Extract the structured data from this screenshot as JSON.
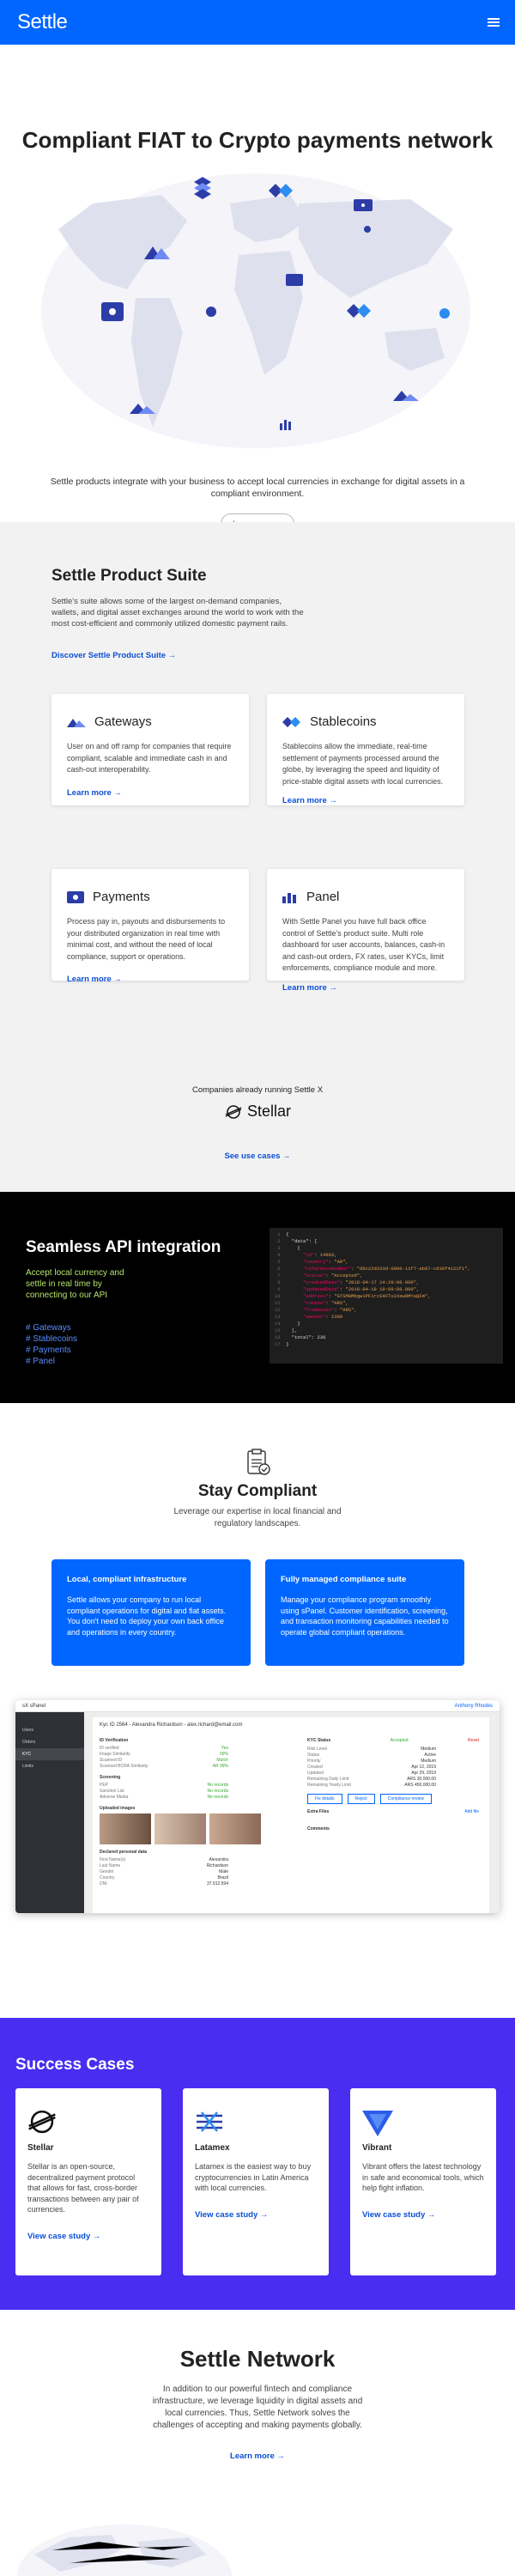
{
  "header": {
    "logo": "Settle"
  },
  "hero": {
    "title": "Compliant FIAT to Crypto payments network",
    "text": "Settle products integrate with your business to accept local currencies in exchange for digital assets in a compliant environment.",
    "cta": "Learn more →"
  },
  "suite": {
    "title": "Settle Product Suite",
    "text": "Settle's suite allows some of the largest on-demand companies, wallets, and digital asset exchanges around the world to work with the most cost-efficient and commonly utilized domestic payment rails.",
    "link": "Discover Settle Product Suite →",
    "cards": [
      {
        "title": "Gateways",
        "text": "User on and off ramp for companies that require compliant, scalable and immediate cash in and cash-out interoperability.",
        "link": "Learn more →",
        "icon": "mountain-icon"
      },
      {
        "title": "Stablecoins",
        "text": "Stablecoins allow the immediate, real-time settlement of payments processed around the globe, by leveraging the speed and liquidity of price-stable digital assets with local currencies.",
        "link": "Learn more →",
        "icon": "diamond-arrows-icon"
      },
      {
        "title": "Payments",
        "text": "Process pay in, payouts and disbursements to your distributed organization in real time with minimal cost, and without the need of local compliance, support or operations.",
        "link": "Learn more →",
        "icon": "card-icon"
      },
      {
        "title": "Panel",
        "text": "With Settle Panel you have full back office control of Settle's product suite. Multi role dashboard for user accounts, balances, cash-in and cash-out orders, FX rates, user KYCs, limit enforcements, compliance module and more.",
        "link": "Learn more →",
        "icon": "bar-chart-icon"
      }
    ],
    "companies": "Companies already running Settle X",
    "stellar": "Stellar",
    "see": "See use cases →"
  },
  "api": {
    "title": "Seamless API integration",
    "text": "Accept local currency and settle in real time by connecting to our API",
    "links": [
      "# Gateways",
      "# Stablecoins",
      "# Payments",
      "# Panel"
    ],
    "code": [
      {
        "n": "1",
        "t": "{"
      },
      {
        "n": "2",
        "t": "  \"data\": ["
      },
      {
        "n": "3",
        "t": "    {"
      },
      {
        "n": "4",
        "k": "      \"id\"",
        "v": ": 14983,"
      },
      {
        "n": "5",
        "k": "      \"country\"",
        "v": ": \"AR\","
      },
      {
        "n": "6",
        "k": "      \"referenceNumber\"",
        "v": ": \"d0c22d333d-0000-11f7-ab67-cd39f4121f1\","
      },
      {
        "n": "7",
        "k": "      \"status\"",
        "v": ": \"Accepted\","
      },
      {
        "n": "8",
        "k": "      \"createdDate\"",
        "v": ": \"2018-04-17 14:20:00.000\","
      },
      {
        "n": "9",
        "k": "      \"updatedDate\"",
        "v": ": \"2018-04-18 10:00:00.000\","
      },
      {
        "n": "10",
        "k": "      \"address\"",
        "v": ": \"GTSM8Mbgw1PF1rcS4FTu1Xew9MYaQFm\","
      },
      {
        "n": "11",
        "k": "      \"tokens\"",
        "v": ": \"ARS\","
      },
      {
        "n": "12",
        "k": "      \"fromAsset\"",
        "v": ": \"ARS\","
      },
      {
        "n": "13",
        "k": "      \"amount\"",
        "v": ": 2300"
      },
      {
        "n": "14",
        "t": "    }"
      },
      {
        "n": "15",
        "t": "  ],"
      },
      {
        "n": "16",
        "t": "  \"total\": 236"
      },
      {
        "n": "17",
        "t": "}"
      }
    ]
  },
  "compliant": {
    "title": "Stay Compliant",
    "text": "Leverage our expertise in local financial and regulatory landscapes.",
    "boxes": [
      {
        "title": "Local, compliant infrastructure",
        "text": "Settle allows your company to run local compliant operations for digital and fiat assets. You don't need to deploy your own back office and operations in every country."
      },
      {
        "title": "Fully managed compliance suite",
        "text": "Manage your compliance program smoothly using sPanel. Customer identification, screening, and transaction monitoring capabilities needed to operate global compliant operations."
      }
    ]
  },
  "panel": {
    "brand": "sX sPanel",
    "user": "Anthony Rhodes",
    "back": "Kyc ID 2564 - Alexandra Richardson - alex.richard@email.com",
    "menu": [
      "Users",
      "Orders",
      "KYC",
      "Limits"
    ],
    "status_label": "KYC Status",
    "status": "Accepted",
    "reset": "Reset",
    "kyc": [
      [
        "Risk Level",
        "Medium"
      ],
      [
        "Status",
        "Active"
      ],
      [
        "Priority",
        "Medium"
      ],
      [
        "Created",
        "Apr 12, 2019"
      ],
      [
        "Updated",
        "Apr 29, 2019"
      ],
      [
        "Remaining Daily Limit",
        "ARS 30,000.00"
      ],
      [
        "Remaining Yearly Limit",
        "ARS 450,000.00"
      ]
    ],
    "actions": [
      "Fix details",
      "Reject",
      "Compliance review"
    ],
    "id_title": "ID Verification",
    "id_rows": [
      [
        "ID verified",
        "Yes"
      ],
      [
        "Image Similarity",
        "99%"
      ],
      [
        "Scanned ID",
        "Match"
      ],
      [
        "Scanned BCRA Similarity",
        "AR 99%"
      ]
    ],
    "screening": "Screening",
    "scr_rows": [
      [
        "PEP",
        "No records"
      ],
      [
        "Sanction List",
        "No records"
      ],
      [
        "Adverse Media",
        "No records"
      ]
    ],
    "uploaded": "Uploaded images",
    "personal": "Declared personal data",
    "personal_rows": [
      [
        "First Name(s)",
        "Alexandra"
      ],
      [
        "Last Name",
        "Richardson"
      ],
      [
        "Gender",
        "Male"
      ],
      [
        "Country",
        "Brazil"
      ],
      [
        "DNI",
        "37.912.594"
      ]
    ],
    "extra": "Extra Files",
    "comments": "Comments",
    "add": "Add file"
  },
  "cases": {
    "title": "Success Cases",
    "items": [
      {
        "name": "Stellar",
        "text": "Stellar is an open-source, decentralized payment protocol that allows for fast, cross-border transactions between any pair of currencies.",
        "link": "View case study →"
      },
      {
        "name": "Latamex",
        "text": "Latamex is the easiest way to buy cryptocurrencies in Latin America with local currencies.",
        "link": "View case study →"
      },
      {
        "name": "Vibrant",
        "text": "Vibrant offers the latest technology in safe and economical tools, which help fight inflation.",
        "link": "View case study →"
      }
    ]
  },
  "network": {
    "title": "Settle Network",
    "text": "In addition to our powerful fintech and compliance infrastructure, we leverage liquidity in digital assets and local currencies. Thus, Settle Network solves the challenges of accepting and making payments globally.",
    "link": "Learn more →"
  },
  "colors": {
    "brand": "#0066ff",
    "purple": "#4a2df0",
    "link": "#0b4fd6"
  }
}
